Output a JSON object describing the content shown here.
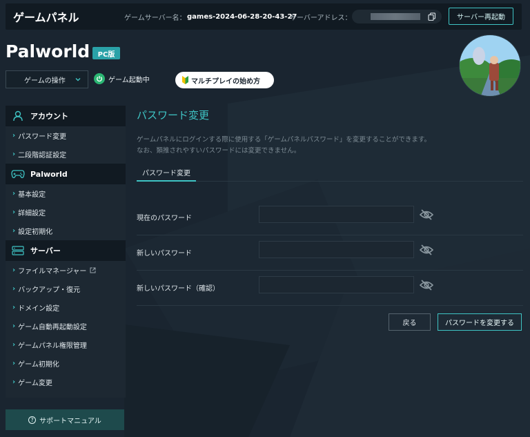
{
  "header": {
    "brand": "ゲームパネル",
    "server_name_label": "ゲームサーバー名：",
    "server_name_value": "games-2024-06-28-20-43-27",
    "server_address_label": "サーバーアドレス：",
    "restart_label": "サーバー再起動"
  },
  "game": {
    "title": "Palworld",
    "platform": "PC版",
    "ops_label": "ゲームの操作",
    "status_text": "ゲーム起動中",
    "multiplay_label": "マルチプレイの始め方"
  },
  "sidebar": {
    "sections": [
      {
        "icon": "user-icon",
        "title": "アカウント",
        "items": [
          "パスワード変更",
          "二段階認証設定"
        ]
      },
      {
        "icon": "gamepad-icon",
        "title": "Palworld",
        "items": [
          "基本設定",
          "詳細設定",
          "設定初期化"
        ]
      },
      {
        "icon": "server-icon",
        "title": "サーバー",
        "items": [
          "ファイルマネージャー",
          "バックアップ・復元",
          "ドメイン設定",
          "ゲーム自動再起動設定",
          "ゲームパネル権限管理",
          "ゲーム初期化",
          "ゲーム変更"
        ]
      }
    ],
    "support_label": "サポートマニュアル"
  },
  "main": {
    "title": "パスワード変更",
    "desc_line1": "ゲームパネルにログインする際に使用する「ゲームパネルパスワード」を変更することができます。",
    "desc_line2": "なお、類推されやすいパスワードには変更できません。",
    "tab": "パスワード変更",
    "fields": [
      {
        "label": "現在のパスワード",
        "value": ""
      },
      {
        "label": "新しいパスワード",
        "value": ""
      },
      {
        "label": "新しいパスワード（確認）",
        "value": ""
      }
    ],
    "back_label": "戻る",
    "submit_label": "パスワードを変更する"
  },
  "colors": {
    "accent": "#3fc5c5",
    "background": "#1a2530",
    "topbar": "#111a22",
    "status_green": "#2bb673"
  }
}
